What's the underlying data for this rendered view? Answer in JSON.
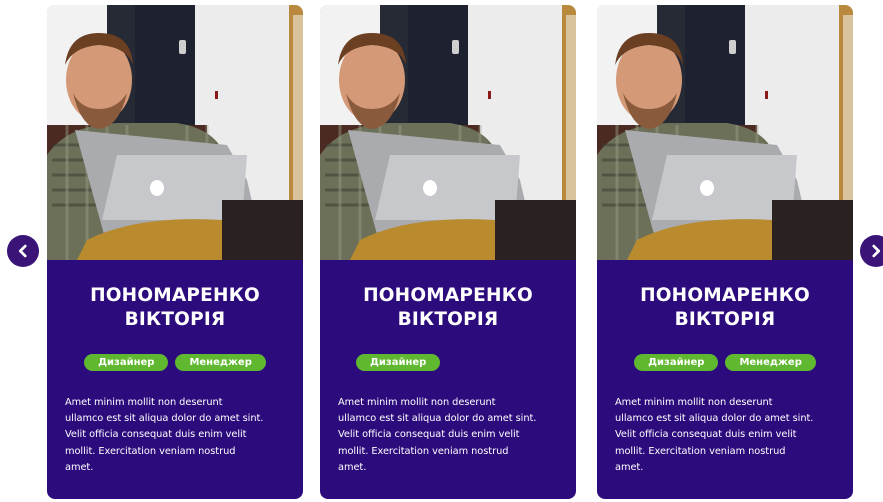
{
  "carousel": {
    "prev_icon": "chevron-left-icon",
    "next_icon": "chevron-right-icon"
  },
  "colors": {
    "card_bg": "#2c0c7d",
    "tag_bg": "#5fb82f",
    "arrow_bg": "#3a1577"
  },
  "cards": [
    {
      "name_line1": "ПОНОМАРЕНКО",
      "name_line2": "ВІКТОРІЯ",
      "tags": [
        "Дизайнер",
        "Менеджер"
      ],
      "desc_lines": [
        "Amet minim mollit non deserunt",
        "ullamco est sit aliqua dolor do amet sint.",
        "Velit officia consequat duis enim velit",
        "mollit. Exercitation veniam nostrud",
        "amet."
      ]
    },
    {
      "name_line1": "ПОНОМАРЕНКО",
      "name_line2": "ВІКТОРІЯ",
      "tags": [
        "Дизайнер"
      ],
      "desc_lines": [
        "Amet minim mollit non deserunt",
        "ullamco est sit aliqua dolor do amet sint.",
        "Velit officia consequat duis enim velit",
        "mollit. Exercitation veniam nostrud",
        "amet."
      ]
    },
    {
      "name_line1": "ПОНОМАРЕНКО",
      "name_line2": "ВІКТОРІЯ",
      "tags": [
        "Дизайнер",
        "Менеджер"
      ],
      "desc_lines": [
        "Amet minim mollit non deserunt",
        "ullamco est sit aliqua dolor do amet sint.",
        "Velit officia consequat duis enim velit",
        "mollit. Exercitation veniam nostrud",
        "amet."
      ]
    }
  ]
}
